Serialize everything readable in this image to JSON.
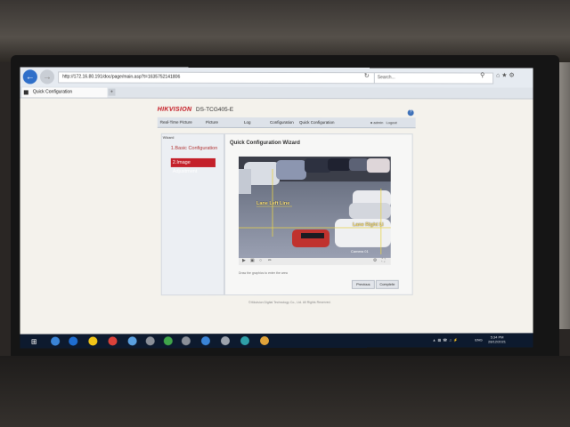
{
  "browser": {
    "url": "http://172.16.80.191/doc/page/main.asp?t=1635752141806",
    "search_placeholder": "Search...",
    "tab_title": "Quick Configuration"
  },
  "header": {
    "logo": "HIKVISION",
    "model": "DS-TCG405-E"
  },
  "menu": {
    "items": [
      "Real-Time Picture",
      "Picture",
      "Log",
      "Configuration",
      "Quick Configuration"
    ],
    "user": "admin",
    "logout": "Logout"
  },
  "sidebar": {
    "title": "Wizard",
    "steps": [
      "1.Basic Configuration",
      "2.Image Adjustment"
    ]
  },
  "main": {
    "title": "Quick Configuration Wizard",
    "hint": "Draw the graphics to enter the area",
    "previous": "Previous",
    "complete": "Complete",
    "footer": "©Hikvision Digital Technology Co., Ltd. All Rights Reserved."
  },
  "video_overlay": {
    "lane_left": "Lane Left Line",
    "lane_right": "Lane Right Li",
    "timestamp": "Camera 01"
  },
  "taskbar": {
    "lang": "ENG",
    "time": "5:34 PM",
    "date": "28/12/2021"
  }
}
